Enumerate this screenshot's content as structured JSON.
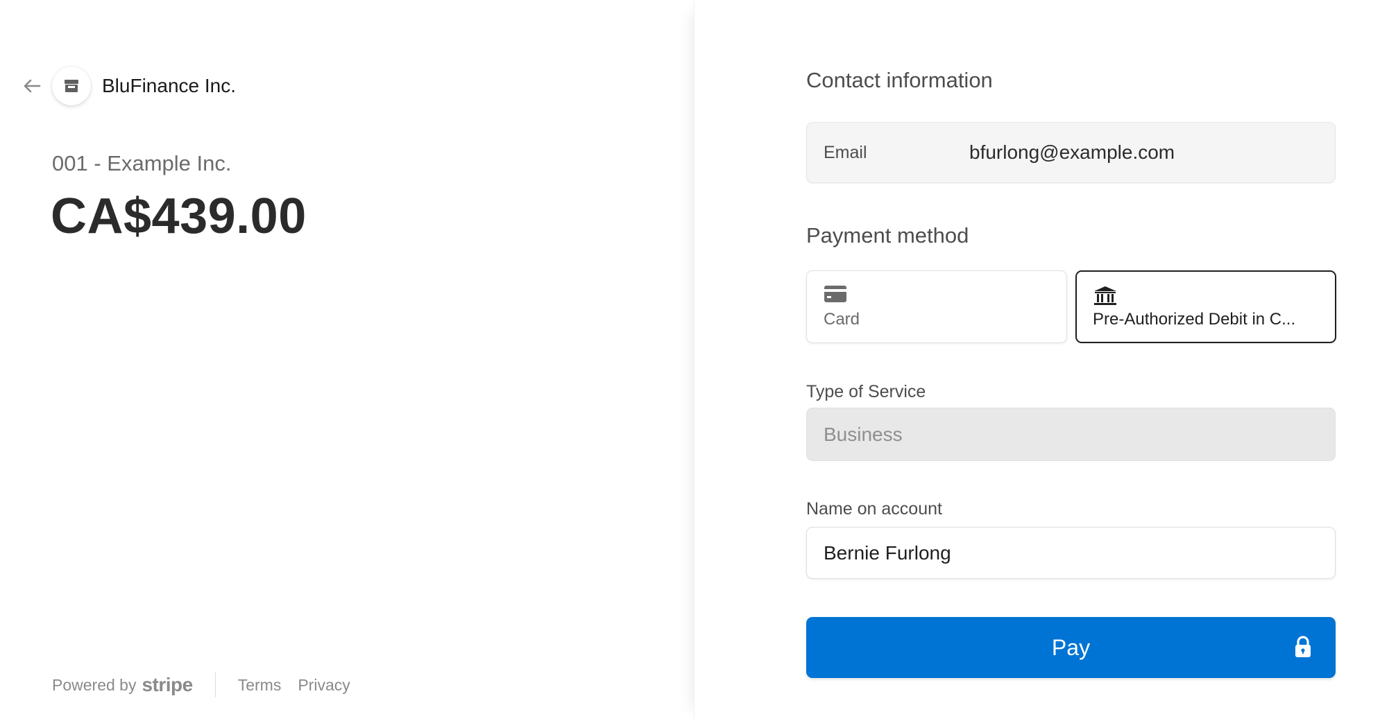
{
  "merchant": {
    "name": "BluFinance Inc."
  },
  "order": {
    "product": "001 - Example Inc.",
    "amount": "CA$439.00"
  },
  "footer": {
    "powered_by": "Powered by",
    "brand": "stripe",
    "links": [
      "Terms",
      "Privacy"
    ]
  },
  "contact": {
    "title": "Contact information",
    "email_label": "Email",
    "email_value": "bfurlong@example.com"
  },
  "payment": {
    "title": "Payment method",
    "methods": [
      {
        "label": "Card",
        "icon": "credit-card-icon",
        "selected": false
      },
      {
        "label": "Pre-Authorized Debit in C...",
        "icon": "bank-icon",
        "selected": true
      }
    ]
  },
  "service": {
    "label": "Type of Service",
    "value": "Business"
  },
  "account_name": {
    "label": "Name on account",
    "value": "Bernie Furlong"
  },
  "pay_button": {
    "label": "Pay"
  },
  "colors": {
    "accent": "#0074d4",
    "text": "#1a1a1a",
    "muted": "#6b6b6b"
  }
}
